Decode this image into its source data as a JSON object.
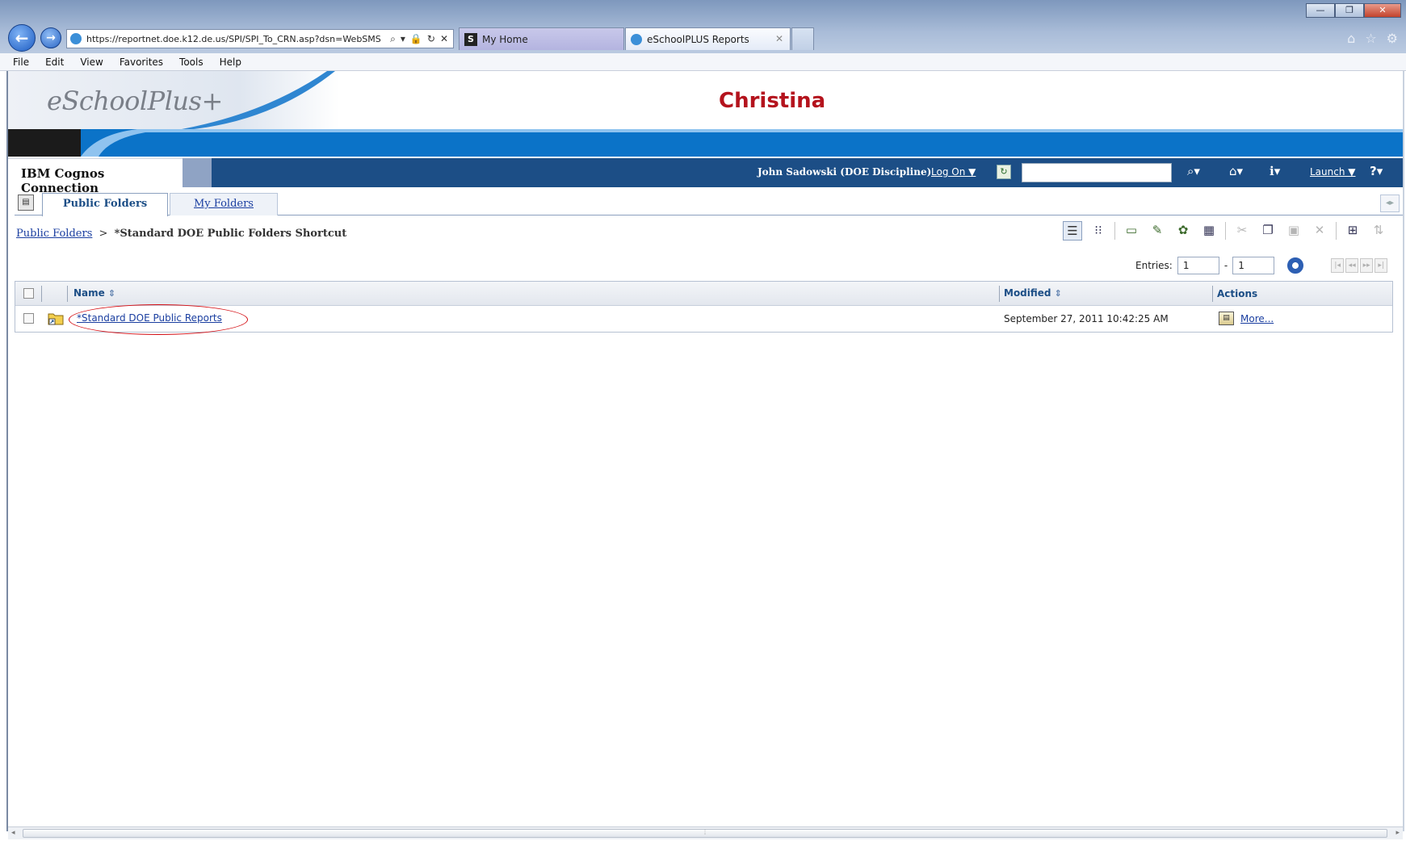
{
  "browser": {
    "address_url": "https://reportnet.doe.k12.de.us/SPI/SPI_To_CRN.asp?dsn=WebSMS",
    "tabs": [
      {
        "label": "My Home",
        "favicon": "S"
      },
      {
        "label": "eSchoolPLUS Reports"
      }
    ],
    "menu": [
      "File",
      "Edit",
      "View",
      "Favorites",
      "Tools",
      "Help"
    ]
  },
  "banner": {
    "logo": "eSchoolPlus+",
    "district": "Christina",
    "colors": {
      "district": "#b4131d",
      "band": "#0b73c8"
    }
  },
  "cognos": {
    "title": "IBM Cognos Connection",
    "user": "John Sadowski (DOE Discipline)",
    "logon_label": "Log On ▼",
    "launch_label": "Launch ▼",
    "search_value": "",
    "bar_color": "#1c4e86"
  },
  "folder_tabs": {
    "public": "Public Folders",
    "my": "My Folders"
  },
  "breadcrumb": {
    "root": "Public Folders",
    "separator": ">",
    "current": "*Standard DOE Public Folders Shortcut"
  },
  "entries": {
    "label": "Entries:",
    "from": "1",
    "dash": "-",
    "to": "1"
  },
  "list": {
    "columns": {
      "name": "Name",
      "modified": "Modified",
      "actions": "Actions"
    },
    "rows": [
      {
        "name": "*Standard DOE Public Reports",
        "modified": "September 27, 2011 10:42:25 AM",
        "action": "More..."
      }
    ]
  }
}
